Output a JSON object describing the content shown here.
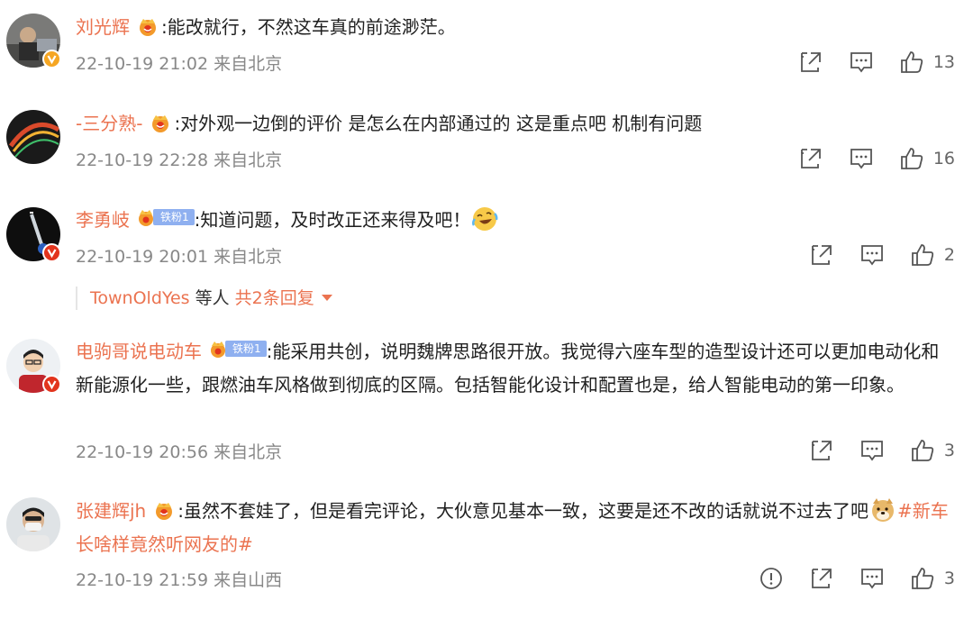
{
  "colors": {
    "accent": "#eb7350",
    "meta": "#888888",
    "fan_badge": "#8fb0f0",
    "verified_gold": "#f5a623",
    "verified_red": "#e2341d"
  },
  "comments": [
    {
      "user": "刘光辉",
      "badge": "crown-icon",
      "text": ":能改就行，不然这车真的前途渺茫。",
      "time": "22-10-19 21:02 来自北京",
      "likes": "13",
      "verified": "gold"
    },
    {
      "user": "-三分熟-",
      "badge": "crown-icon",
      "text": ":对外观一边倒的评价 是怎么在内部通过的 这是重点吧 机制有问题",
      "time": "22-10-19 22:28 来自北京",
      "likes": "16",
      "verified": "none"
    },
    {
      "user": "李勇岐",
      "fan_label": "铁粉1",
      "text": ":知道问题，及时改正还来得及吧！",
      "emoji": "laughing-crying-emoji",
      "time": "22-10-19 20:01 来自北京",
      "likes": "2",
      "verified": "red"
    },
    {
      "user": "电驹哥说电动车",
      "fan_label": "铁粉1",
      "text": ":能采用共创，说明魏牌思路很开放。我觉得六座车型的造型设计还可以更加电动化和新能源化一些，跟燃油车风格做到彻底的区隔。包括智能化设计和配置也是，给人智能电动的第一印象。",
      "time": "22-10-19 20:56 来自北京",
      "likes": "3",
      "verified": "red"
    },
    {
      "user": "张建辉jh",
      "badge": "crown-icon",
      "text": ":虽然不套娃了，但是看完评论，大伙意见基本一致，这要是还不改的话就说不过去了吧",
      "emoji": "doge-emoji",
      "hashtag": "#新车长啥样竟然听网友的#",
      "time": "22-10-19 21:59 来自山西",
      "likes": "3",
      "verified": "none"
    }
  ],
  "reply_summary": {
    "user": "TownOldYes",
    "connector": " 等人",
    "more": "共2条回复"
  }
}
